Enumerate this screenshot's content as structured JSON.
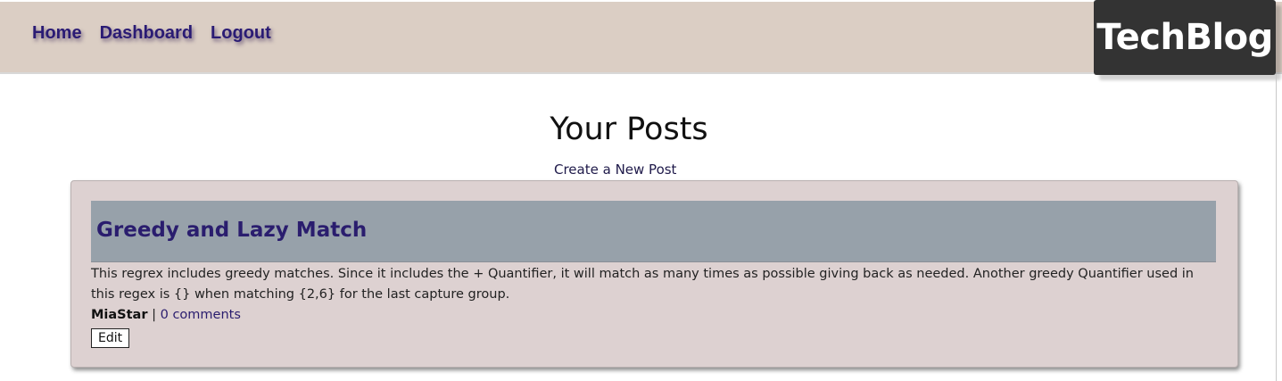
{
  "nav": {
    "links": [
      {
        "label": "Home"
      },
      {
        "label": "Dashboard"
      },
      {
        "label": "Logout"
      }
    ],
    "brand": "TechBlog"
  },
  "page": {
    "title": "Your Posts",
    "new_post_link": "Create a New Post"
  },
  "posts": [
    {
      "title": "Greedy and Lazy Match",
      "body": "This regrex includes greedy matches. Since it includes the + Quantifier, it will match as many times as possible giving back as needed. Another greedy Quantifier used in this regex is {} when matching {2,6} for the last capture group.",
      "author": "MiaStar",
      "separator": " | ",
      "comments_label": "0 comments",
      "edit_label": "Edit"
    }
  ],
  "colors": {
    "navbar_bg": "#dbcec4",
    "nav_link": "#2a1b74",
    "brand_bg": "#333333",
    "card_bg": "#ddd1d1",
    "card_header_bg": "#97a1aa",
    "post_title": "#2a1d6e"
  }
}
